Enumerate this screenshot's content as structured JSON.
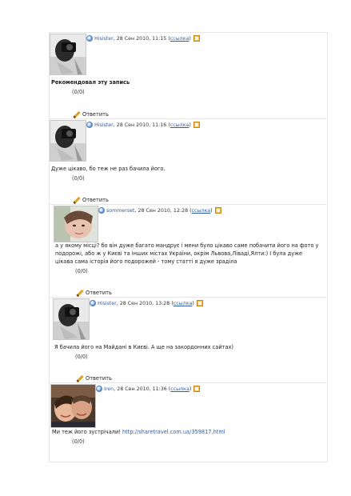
{
  "comments": [
    {
      "author": "Hisister",
      "date": ", 28 Сен 2010, 11:15 (",
      "link": "ссылка",
      "close": ")",
      "text": "Рекомендовал эту запись",
      "score": "(0/0)",
      "reply": "Ответить"
    },
    {
      "author": "Hisister",
      "date": ", 28 Сен 2010, 11:16 (",
      "link": "ссылка",
      "close": ")",
      "text": "Дуже цікаво, бо теж не раз бачила його.",
      "score": "(0/0)",
      "reply": "Ответить"
    },
    {
      "author": "sommerset",
      "date": ", 28 Сен 2010, 12:28 (",
      "link": "ссылка",
      "close": ")",
      "text_lines": [
        "а у якому місці? бо він дуже багато мандрує і мени було цікаво саме побачити його на фото у",
        "подорожі, або ж у Києві та інших містах України, окрім Львова,Ліваді,Ялти:) І була дуже",
        "цікава сама історія його подорожей - тому статті я дуже зраділа"
      ],
      "score": "(0/0)",
      "reply": "Ответить"
    },
    {
      "author": "Hisister",
      "date": ", 28 Сен 2010, 13:28 (",
      "link": "ссылка",
      "close": ")",
      "text": "Я бачила його на Майдані в Києві. А ще на закордонних сайтах)",
      "score": "(0/0)",
      "reply": "Ответить"
    },
    {
      "author": "Iren",
      "date": ", 28 Сен 2010, 11:36 (",
      "link": "ссылка",
      "close": ")",
      "text": "Ми теж його зустрічали! ",
      "url": "http://sharetravel.com.ua/359817.html",
      "score": "(0/0)"
    }
  ]
}
